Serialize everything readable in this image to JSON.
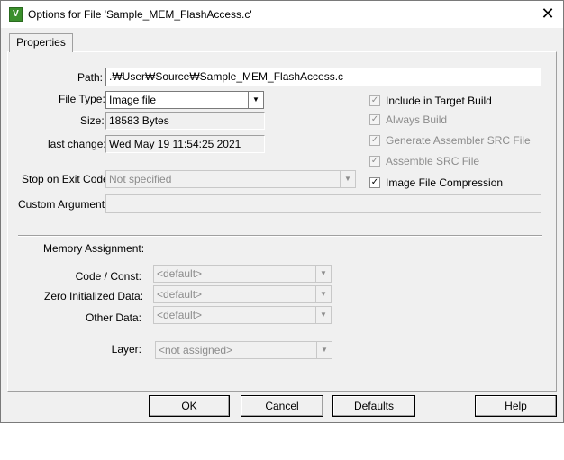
{
  "window": {
    "title": "Options for File 'Sample_MEM_FlashAccess.c'",
    "icon": "keil-uvision-icon",
    "close_glyph": "✕"
  },
  "tabs": [
    {
      "label": "Properties"
    }
  ],
  "properties": {
    "path_label": "Path:",
    "path_value": ".₩User₩Source₩Sample_MEM_FlashAccess.c",
    "file_type_label": "File Type:",
    "file_type_value": "Image file",
    "size_label": "Size:",
    "size_value": "18583 Bytes",
    "last_change_label": "last change:",
    "last_change_value": "Wed May 19 11:54:25 2021",
    "stop_label": "Stop on Exit Code:",
    "stop_value": "Not specified",
    "custom_label": "Custom Arguments:",
    "custom_value": ""
  },
  "checkboxes": [
    {
      "label": "Include in Target Build",
      "checked": true,
      "enabled": false
    },
    {
      "label": "Always Build",
      "checked": true,
      "enabled": false
    },
    {
      "label": "Generate Assembler SRC File",
      "checked": true,
      "enabled": false
    },
    {
      "label": "Assemble SRC File",
      "checked": true,
      "enabled": false
    },
    {
      "label": "Image File Compression",
      "checked": true,
      "enabled": true
    }
  ],
  "memory": {
    "heading": "Memory Assignment:",
    "code_label": "Code / Const:",
    "code_value": "<default>",
    "zero_label": "Zero Initialized Data:",
    "zero_value": "<default>",
    "other_label": "Other Data:",
    "other_value": "<default>",
    "layer_label": "Layer:",
    "layer_value": "<not assigned>"
  },
  "buttons": {
    "ok": "OK",
    "cancel": "Cancel",
    "defaults": "Defaults",
    "help": "Help"
  },
  "glyphs": {
    "check": "✓",
    "combo": "▼"
  }
}
